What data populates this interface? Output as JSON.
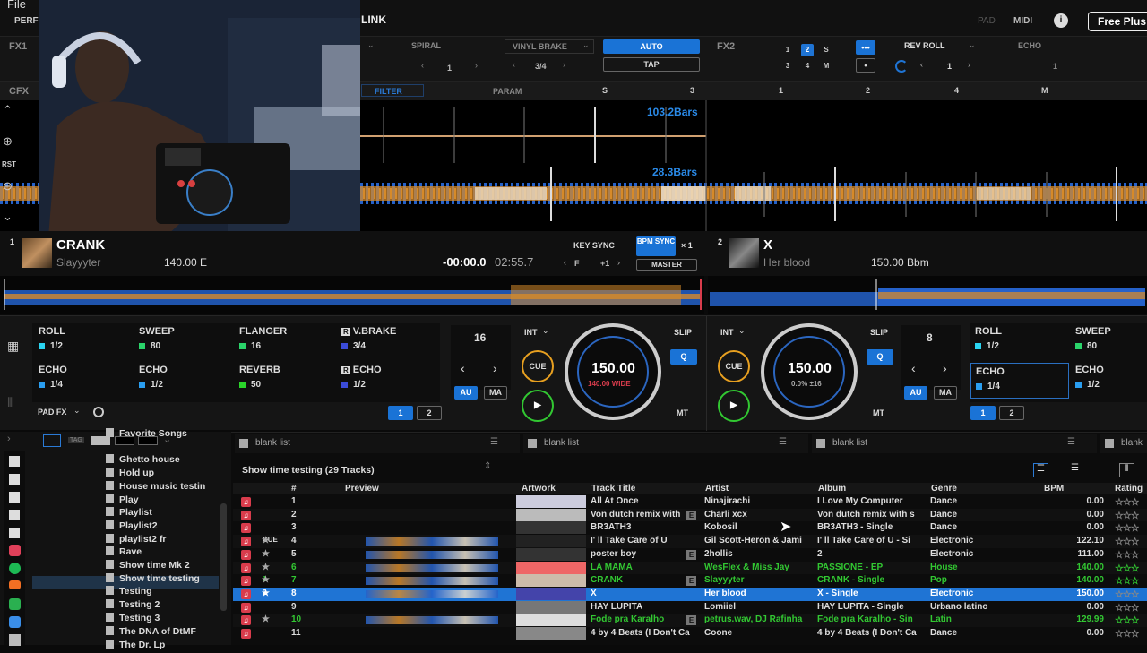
{
  "app": {
    "menu": "File",
    "mode": "PERFO",
    "link": "LINK",
    "pad": "PAD",
    "midi": "MIDI",
    "info": "i",
    "free_plus": "Free Plus"
  },
  "fx": {
    "fx1_label": "FX1",
    "fx2_label": "FX2",
    "cfx_label": "CFX",
    "fx1_spiral": "SPIRAL",
    "fx1_spiral_val": "1",
    "fx1_vinyl": "VINYL BRAKE",
    "fx1_vinyl_val": "3/4",
    "auto": "AUTO",
    "tap": "TAP",
    "fx2_nums": [
      "1",
      "2",
      "S",
      "3",
      "4",
      "M"
    ],
    "fx2_more": "•••",
    "fx2_dot": "•",
    "fx2_rev": "REV ROLL",
    "fx2_rev_val": "1",
    "fx2_echo": "ECHO",
    "fx2_echo_val": "1",
    "cfx_filter": "FILTER",
    "cfx_param": "PARAM",
    "cfx_s": "S",
    "cfx_3": "3",
    "cfx_1": "1",
    "cfx_2": "2",
    "cfx_4": "4",
    "cfx_m": "M"
  },
  "wave": {
    "bars1": "103.2Bars",
    "bars2": "28.3Bars",
    "rst": "RST"
  },
  "deck1": {
    "num": "1",
    "title": "CRANK",
    "artist": "Slayyyter",
    "bpm_key": "140.00 E",
    "elapsed": "-00:00.0",
    "remain": "02:55.7",
    "key_sync": "KEY SYNC",
    "bpm_sync": "BPM SYNC",
    "x1": "× 1",
    "f": "F",
    "plus1": "+1",
    "master": "MASTER",
    "pad_fx": [
      {
        "name": "ROLL",
        "val": "1/2",
        "color": "#2ad4f0"
      },
      {
        "name": "SWEEP",
        "val": "80",
        "color": "#2ad46a"
      },
      {
        "name": "FLANGER",
        "val": "16",
        "color": "#2ad46a"
      },
      {
        "name": "V.BRAKE",
        "val": "3/4",
        "color": "#3b4bd8"
      },
      {
        "name": "ECHO",
        "val": "1/4",
        "color": "#2a9ef0"
      },
      {
        "name": "ECHO",
        "val": "1/2",
        "color": "#2a9ef0"
      },
      {
        "name": "REVERB",
        "val": "50",
        "color": "#2ad42a"
      },
      {
        "name": "ECHO",
        "val": "1/2",
        "color": "#3b4bd8"
      }
    ],
    "pad_fx_label": "PAD FX",
    "beat": "16",
    "int": "INT",
    "au": "AU",
    "ma": "MA",
    "cue": "CUE",
    "slip": "SLIP",
    "q": "Q",
    "mt": "MT",
    "tempo": "150.00",
    "tempo_sub": "140.00 WIDE",
    "page1": "1",
    "page2": "2",
    "r": "R"
  },
  "deck2": {
    "num": "2",
    "title": "X",
    "artist": "Her blood",
    "bpm_key": "150.00 Bbm",
    "pad_fx": [
      {
        "name": "ROLL",
        "val": "1/2",
        "color": "#2ad4f0"
      },
      {
        "name": "SWEEP",
        "val": "80",
        "color": "#2ad46a"
      },
      {
        "name": "ECHO",
        "val": "1/4",
        "color": "#2a9ef0"
      },
      {
        "name": "ECHO",
        "val": "1/2",
        "color": "#2a9ef0"
      }
    ],
    "beat": "8",
    "int": "INT",
    "au": "AU",
    "ma": "MA",
    "cue": "CUE",
    "slip": "SLIP",
    "q": "Q",
    "mt": "MT",
    "tempo": "150.00",
    "tempo_sub": "0.0% ±16",
    "page1": "1",
    "page2": "2"
  },
  "sidebar": {
    "tag": "TAG",
    "items": [
      "Favorite Songs",
      "Ghetto house",
      "Hold up",
      "House music testin",
      "Play",
      "Playlist",
      "Playlist2",
      "playlist2 fr",
      "Rave",
      "Show time Mk 2",
      "Show time testing",
      "Testing",
      "Testing 2",
      "Testing 3",
      "The DNA of DtMF",
      "The Dr. Lp"
    ],
    "selected": "Show time testing"
  },
  "browser": {
    "tabs": [
      "blank list",
      "blank list",
      "blank list",
      "blank"
    ],
    "list_title": "Show time testing  (29 Tracks)",
    "columns": [
      "#",
      "Preview",
      "Artwork",
      "Track Title",
      "Artist",
      "Album",
      "Genre",
      "BPM",
      "Rating"
    ],
    "rows": [
      {
        "n": "1",
        "title": "All At Once",
        "artist": "Ninajirachi",
        "album": "I Love My Computer",
        "genre": "Dance",
        "bpm": "0.00",
        "style": "",
        "e": false,
        "deck": ""
      },
      {
        "n": "2",
        "title": "Von dutch remix with",
        "artist": "Charli xcx",
        "album": "Von dutch remix with s",
        "genre": "Dance",
        "bpm": "0.00",
        "style": "",
        "e": true,
        "deck": ""
      },
      {
        "n": "3",
        "title": "BR3ATH3",
        "artist": "Kobosil",
        "album": "BR3ATH3 - Single",
        "genre": "Dance",
        "bpm": "0.00",
        "style": "",
        "e": false,
        "deck": ""
      },
      {
        "n": "4",
        "title": "I' ll Take Care of U",
        "artist": "Gil Scott-Heron & Jami",
        "album": "I' ll Take Care of U - Si",
        "genre": "Electronic",
        "bpm": "122.10",
        "style": "",
        "e": false,
        "deck": "CUE"
      },
      {
        "n": "5",
        "title": "poster boy",
        "artist": "2hollis",
        "album": "2",
        "genre": "Electronic",
        "bpm": "111.00",
        "style": "",
        "e": true,
        "deck": ""
      },
      {
        "n": "6",
        "title": "LA MAMA",
        "artist": "WesFlex & Miss Jay",
        "album": "PASSIONE - EP",
        "genre": "House",
        "bpm": "140.00",
        "style": "green",
        "e": false,
        "deck": ""
      },
      {
        "n": "7",
        "title": "CRANK",
        "artist": "Slayyyter",
        "album": "CRANK - Single",
        "genre": "Pop",
        "bpm": "140.00",
        "style": "green",
        "e": true,
        "deck": "1"
      },
      {
        "n": "8",
        "title": "X",
        "artist": "Her blood",
        "album": "X - Single",
        "genre": "Electronic",
        "bpm": "150.00",
        "style": "sel",
        "e": false,
        "deck": "2"
      },
      {
        "n": "9",
        "title": "HAY LUPITA",
        "artist": "Lomiiel",
        "album": "HAY LUPITA - Single",
        "genre": "Urbano latino",
        "bpm": "0.00",
        "style": "",
        "e": false,
        "deck": ""
      },
      {
        "n": "10",
        "title": "Fode pra Karalho",
        "artist": "petrus.wav, DJ Rafinha",
        "album": "Fode pra Karalho - Sin",
        "genre": "Latin",
        "bpm": "129.99",
        "style": "green",
        "e": true,
        "deck": ""
      },
      {
        "n": "11",
        "title": "4 by 4 Beats (I Don't Ca",
        "artist": "Coone",
        "album": "4 by 4 Beats (I Don't Ca",
        "genre": "Dance",
        "bpm": "0.00",
        "style": "",
        "e": false,
        "deck": ""
      }
    ]
  },
  "colors": {
    "accent": "#1f74d4",
    "orange": "#d68a2a",
    "wave_blue": "#2561c9",
    "green": "#32c832",
    "red": "#d93c4c"
  }
}
